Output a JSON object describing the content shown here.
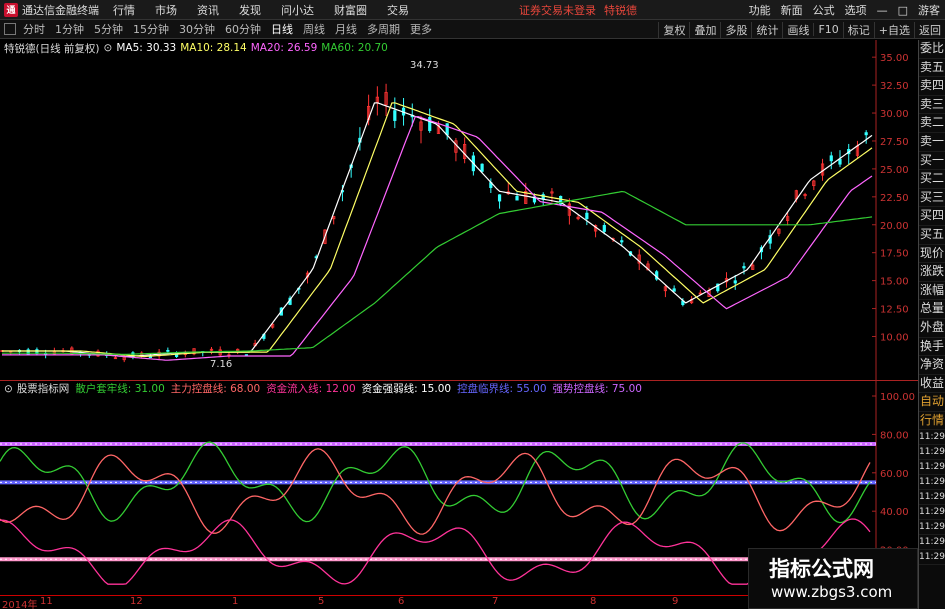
{
  "menubar": {
    "logo_char": "通",
    "app_title": "通达信金融终端",
    "items": [
      "行情",
      "市场",
      "资讯",
      "发现",
      "问小达",
      "财富圈",
      "交易"
    ],
    "trade_status": "证券交易未登录",
    "stock_name": "特锐德",
    "right_items": [
      "功能",
      "新面",
      "公式",
      "选项"
    ],
    "user": "游客"
  },
  "periodbar": {
    "tabs": [
      "分时",
      "1分钟",
      "5分钟",
      "15分钟",
      "30分钟",
      "60分钟",
      "日线",
      "周线",
      "月线",
      "多周期",
      "更多"
    ],
    "active_tab": "日线",
    "right_tools": [
      "复权",
      "叠加",
      "多股",
      "统计",
      "画线",
      "F10",
      "标记",
      "+自选",
      "返回"
    ]
  },
  "infoline": {
    "title": "特锐德(日线 前复权)",
    "ma5_label": "MA5: 30.33",
    "ma10_label": "MA10: 28.14",
    "ma20_label": "MA20: 26.59",
    "ma60_label": "MA60: 20.70",
    "colors": {
      "ma5": "#ffffff",
      "ma10": "#ffff66",
      "ma20": "#ff66ff",
      "ma60": "#33cc33"
    }
  },
  "indicator_info": {
    "name": "股票指标网",
    "labels": [
      {
        "text": "散户套牢线: 31.00",
        "color": "#33cc33"
      },
      {
        "text": "主力控盘线: 68.00",
        "color": "#ff6666"
      },
      {
        "text": "资金流入线: 12.00",
        "color": "#ff3399"
      },
      {
        "text": "资金强弱线: 15.00",
        "color": "#ffffff"
      },
      {
        "text": "控盘临界线: 55.00",
        "color": "#6666ff"
      },
      {
        "text": "强势控盘线: 75.00",
        "color": "#cc66ff"
      }
    ]
  },
  "price_axis": [
    "35.00",
    "32.50",
    "30.00",
    "27.50",
    "25.00",
    "22.50",
    "20.00",
    "17.50",
    "15.00",
    "12.50",
    "10.00"
  ],
  "ind_axis": [
    "100.00",
    "80.00",
    "60.00",
    "40.00",
    "20.00"
  ],
  "annotations": {
    "high": "34.73",
    "low": "7.16"
  },
  "date_axis": [
    "2014年",
    "11",
    "12",
    "1",
    "5",
    "6",
    "7",
    "8",
    "9"
  ],
  "right_panel": {
    "top_text": "委比",
    "items": [
      "委比",
      "卖五",
      "卖四",
      "卖三",
      "卖二",
      "卖一",
      "买一",
      "买二",
      "买三",
      "买四",
      "买五",
      "现价",
      "涨跌",
      "涨幅",
      "总量",
      "外盘",
      "换手",
      "净资",
      "收益"
    ],
    "lower_items": [
      "自动",
      "行情"
    ],
    "times": [
      "11:29",
      "11:29",
      "11:29",
      "11:29",
      "11:29",
      "11:29",
      "11:29",
      "11:29",
      "11:29"
    ]
  },
  "watermark": {
    "title": "指标公式网",
    "url": "www.zbgs3.com"
  },
  "chart_data": {
    "type": "line",
    "title": "特锐德(日线 前复权)",
    "price": {
      "ylim": [
        7,
        36
      ],
      "x": [
        0,
        10,
        20,
        30,
        40,
        50,
        60,
        70,
        80,
        90,
        100
      ],
      "ma5": [
        8.7,
        8.7,
        8.2,
        8.6,
        8.6,
        16,
        31,
        29,
        23,
        22,
        18,
        13,
        16,
        24,
        28
      ],
      "ma60": [
        8.5,
        8.5,
        8.4,
        8.6,
        8.7,
        9,
        13,
        18,
        21,
        22,
        23,
        20,
        20,
        20,
        20.7
      ]
    },
    "indicator": {
      "ylim": [
        0,
        100
      ],
      "lines": [
        {
          "name": "强势控盘线",
          "value": 75
        },
        {
          "name": "控盘临界线",
          "value": 55
        },
        {
          "name": "资金强弱线",
          "value": 15
        }
      ]
    }
  }
}
